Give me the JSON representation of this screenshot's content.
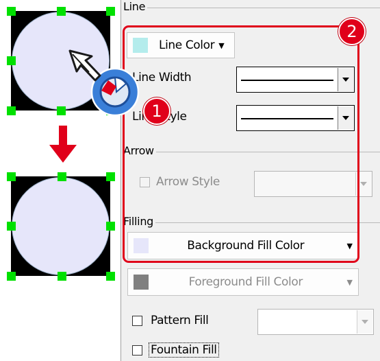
{
  "panel": {
    "line_group": {
      "title": "Line",
      "line_color": {
        "label": "Line Color",
        "swatch": "#b4ecec"
      },
      "line_width_label": "Line Width",
      "line_style_label": "Line Style"
    },
    "arrow_group": {
      "title": "Arrow",
      "arrow_style_label": "Arrow Style"
    },
    "filling_group": {
      "title": "Filling",
      "background_fill": {
        "label": "Background Fill Color",
        "swatch": "#e6e6fa"
      },
      "foreground_fill": {
        "label": "Foreground Fill Color",
        "swatch": "#808080"
      },
      "pattern_fill_label": "Pattern Fill",
      "fountain_fill_label": "Fountain Fill"
    }
  },
  "annotations": {
    "badge_1": "1",
    "badge_2": "2"
  },
  "colors": {
    "circle_fill": "#e6e6fa",
    "handle": "#00e000",
    "accent_red": "#e0001a",
    "pointer_blue": "#3a7fd8"
  },
  "icons": [
    "mouse-pointer-icon",
    "double-click-icon",
    "down-arrow-icon"
  ]
}
